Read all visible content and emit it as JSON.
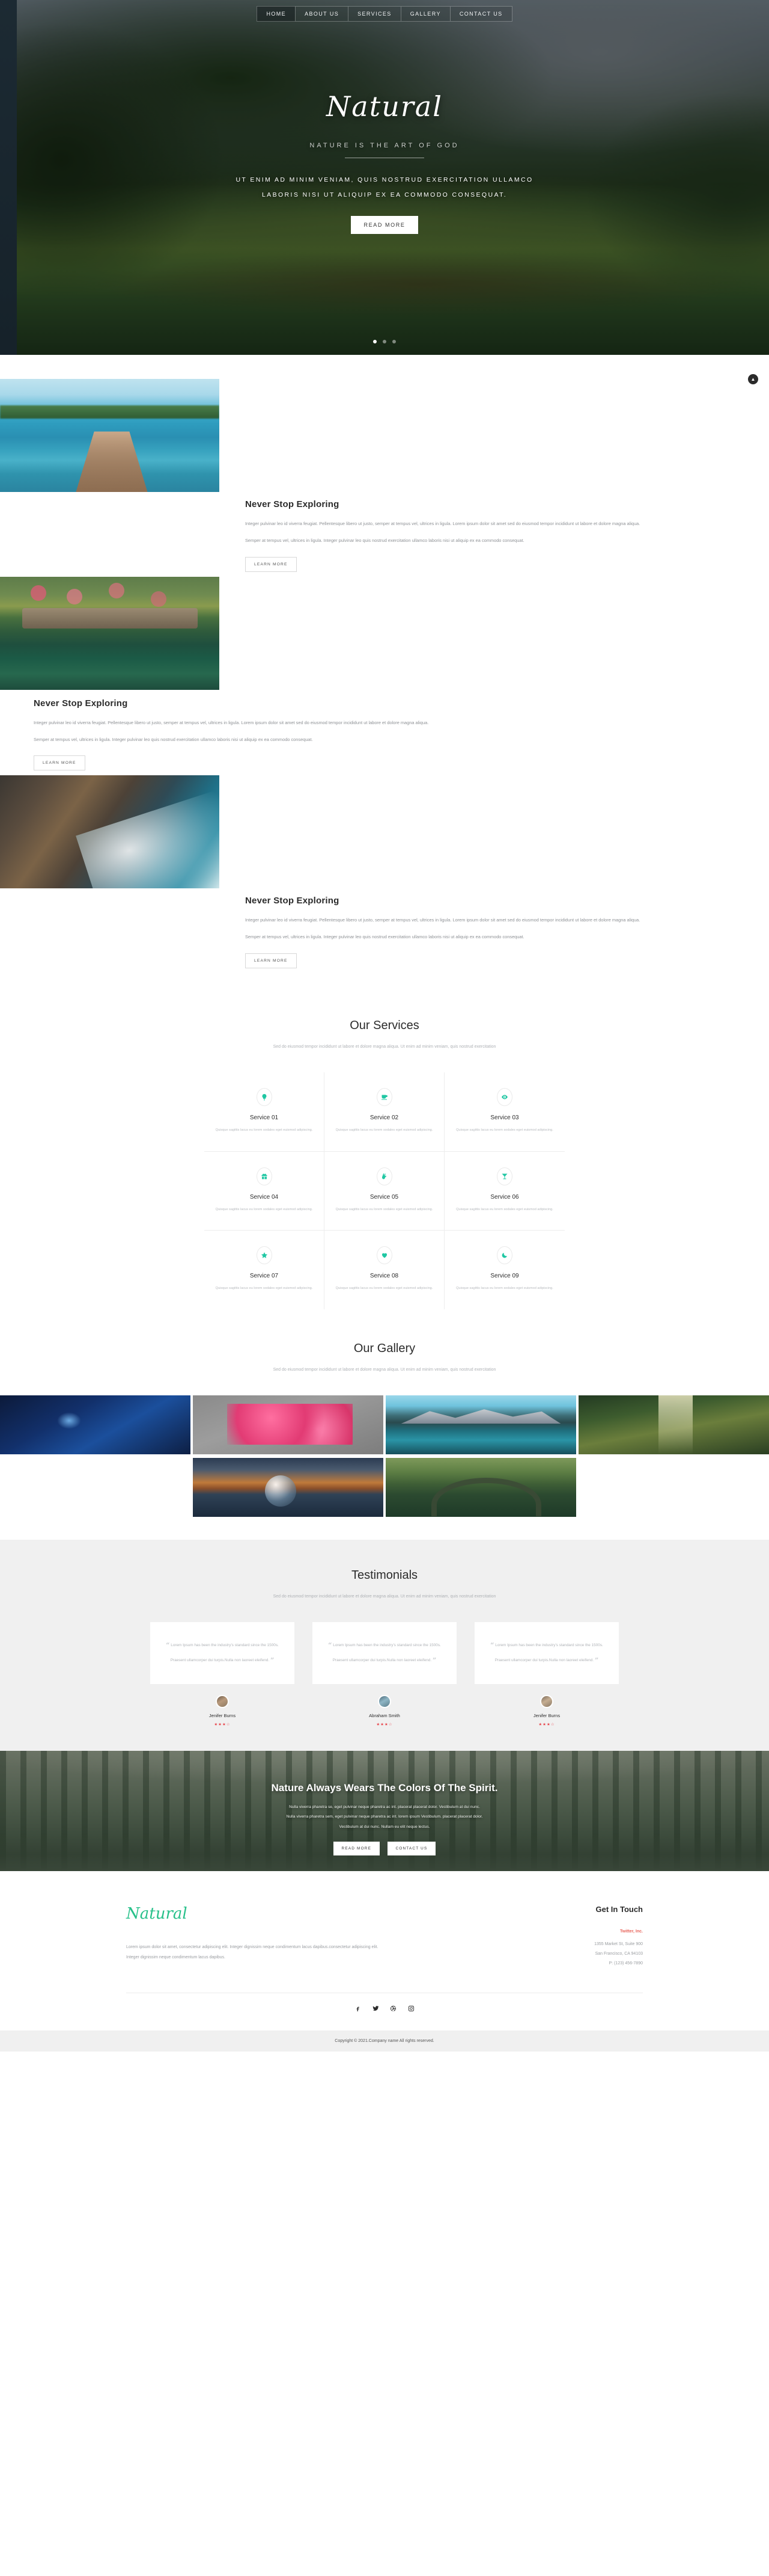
{
  "nav": {
    "items": [
      {
        "label": "HOME",
        "active": true
      },
      {
        "label": "ABOUT US",
        "active": false
      },
      {
        "label": "SERVICES",
        "active": false
      },
      {
        "label": "GALLERY",
        "active": false
      },
      {
        "label": "CONTACT US",
        "active": false
      }
    ]
  },
  "hero": {
    "title": "Natural",
    "tagline": "NATURE IS THE ART OF GOD",
    "sub_line1": "UT ENIM AD MINIM VENIAM, QUIS NOSTRUD EXERCITATION ULLAMCO",
    "sub_line2": "LABORIS NISI UT ALIQUIP EX EA COMMODO CONSEQUAT.",
    "button": "READ MORE"
  },
  "about": {
    "scroll_top_icon": "▲",
    "blocks": [
      {
        "heading": "Never Stop Exploring",
        "p1": "Integer pulvinar leo id viverra feugiat. Pellentesque libero ut justo, semper at tempus vel, ultrices in ligula. Lorem ipsum dolor sit amet sed do eiusmod tempor incididunt ut labore et dolore magna aliqua.",
        "p2": "Semper at tempus vel, ultrices in ligula. Integer pulvinar leo quis nostrud exercitation ullamco laboris nisi ut aliquip ex ea commodo consequat.",
        "button": "LEARN MORE",
        "image": "beach-pier-photo",
        "side": "left"
      },
      {
        "heading": "Never Stop Exploring",
        "p1": "Integer pulvinar leo id viverra feugiat. Pellentesque libero ut justo, semper at tempus vel, ultrices in ligula. Lorem ipsum dolor sit amet sed do eiusmod tempor incididunt ut labore et dolore magna aliqua.",
        "p2": "Semper at tempus vel, ultrices in ligula. Integer pulvinar leo quis nostrud exercitation ullamco laboris nisi ut aliquip ex ea commodo consequat.",
        "button": "LEARN MORE",
        "image": "garden-bridge-photo",
        "side": "right"
      },
      {
        "heading": "Never Stop Exploring",
        "p1": "Integer pulvinar leo id viverra feugiat. Pellentesque libero ut justo, semper at tempus vel, ultrices in ligula. Lorem ipsum dolor sit amet sed do eiusmod tempor incididunt ut labore et dolore magna aliqua.",
        "p2": "Semper at tempus vel, ultrices in ligula. Integer pulvinar leo quis nostrud exercitation ullamco laboris nisi ut aliquip ex ea commodo consequat.",
        "button": "LEARN MORE",
        "image": "coastal-cliff-photo",
        "side": "left"
      }
    ]
  },
  "services": {
    "heading": "Our Services",
    "subtitle": "Sed do eiusmod tempor incididunt ut labore et dolore magna aliqua. Ut enim ad minim veniam, quis nostrud exercitation",
    "items": [
      {
        "title": "Service 01",
        "desc": "Quisque sagittis lacus eu lorem sodales eget euismod adipiscing.",
        "icon": "lightbulb-icon"
      },
      {
        "title": "Service 02",
        "desc": "Quisque sagittis lacus eu lorem sodales eget euismod adipiscing.",
        "icon": "coffee-cup-icon"
      },
      {
        "title": "Service 03",
        "desc": "Quisque sagittis lacus eu lorem sodales eget euismod adipiscing.",
        "icon": "eye-icon"
      },
      {
        "title": "Service 04",
        "desc": "Quisque sagittis lacus eu lorem sodales eget euismod adipiscing.",
        "icon": "gift-icon"
      },
      {
        "title": "Service 05",
        "desc": "Quisque sagittis lacus eu lorem sodales eget euismod adipiscing.",
        "icon": "peace-hand-icon"
      },
      {
        "title": "Service 06",
        "desc": "Quisque sagittis lacus eu lorem sodales eget euismod adipiscing.",
        "icon": "cocktail-icon"
      },
      {
        "title": "Service 07",
        "desc": "Quisque sagittis lacus eu lorem sodales eget euismod adipiscing.",
        "icon": "star-icon"
      },
      {
        "title": "Service 08",
        "desc": "Quisque sagittis lacus eu lorem sodales eget euismod adipiscing.",
        "icon": "heart-icon"
      },
      {
        "title": "Service 09",
        "desc": "Quisque sagittis lacus eu lorem sodales eget euismod adipiscing.",
        "icon": "moon-icon"
      }
    ],
    "accent_color": "#1fc7a3"
  },
  "gallery": {
    "heading": "Our Gallery",
    "subtitle": "Sed do eiusmod tempor incididunt ut labore et dolore magna aliqua. Ut enim ad minim veniam, quis nostrud exercitation",
    "images": [
      "blue-forest-mushroom-photo",
      "pink-blossom-photo",
      "mountain-lake-photo",
      "forest-light-photo",
      "crystal-ball-sunset-photo",
      "stone-arch-bridge-photo"
    ]
  },
  "testimonials": {
    "heading": "Testimonials",
    "subtitle": "Sed do eiusmod tempor incididunt ut labore et dolore magna aliqua. Ut enim ad minim veniam, quis nostrud exercitation",
    "quote_open": "“",
    "quote_close": "”",
    "items": [
      {
        "quote": "Lorem Ipsum has been the industry's standard since the 1500s. Praesent ullamcorper dui turpis.Nulla non laoreet eleifend.",
        "name": "Jenifer Burns",
        "stars": "★★★☆"
      },
      {
        "quote": "Lorem Ipsum has been the industry's standard since the 1500s. Praesent ullamcorper dui turpis.Nulla non laoreet eleifend.",
        "name": "Abraham Smith",
        "stars": "★★★☆"
      },
      {
        "quote": "Lorem Ipsum has been the industry's standard since the 1500s. Praesent ullamcorper dui turpis.Nulla non laoreet eleifend.",
        "name": "Jenifer Burns",
        "stars": "★★★☆"
      }
    ],
    "star_color": "#e8444a"
  },
  "cta": {
    "heading": "Nature Always Wears The Colors Of The Spirit.",
    "line1": "Nulla viverra pharetra se, eget pulvinar neque pharetra ac int. placerat placerat dolor. Vestibulum at dui nunc.",
    "line2": "Nulla viverra pharetra sem, eget pulvinar neque pharetra ac int. lorem ipsum Vestibulum. placerat placerat dolor.",
    "line3": "Vestibulum at dui nunc. Nullam eu elit neque lectus.",
    "button1": "READ MORE",
    "button2": "CONTACT US"
  },
  "footer": {
    "logo": "Natural",
    "about_text": "Lorem ipsum dolor sit amet, consectetur adipiscing elit. Integer dignissim neque condimentum lacus dapibus.consectetur adipiscing elit. Integer dignissim neque condimentum lacus dapibus.",
    "contact_heading": "Get In Touch",
    "company": "Twitter, Inc.",
    "address1": "1355 Market St, Suite 900",
    "address2": "San Francisco, CA 94103",
    "phone": "P: (123) 456-7890",
    "social": [
      "facebook-icon",
      "twitter-icon",
      "dribbble-icon",
      "instagram-icon"
    ],
    "copyright": "Copyright © 2021.Company name All rights reserved.",
    "logo_color": "#27c08a"
  }
}
